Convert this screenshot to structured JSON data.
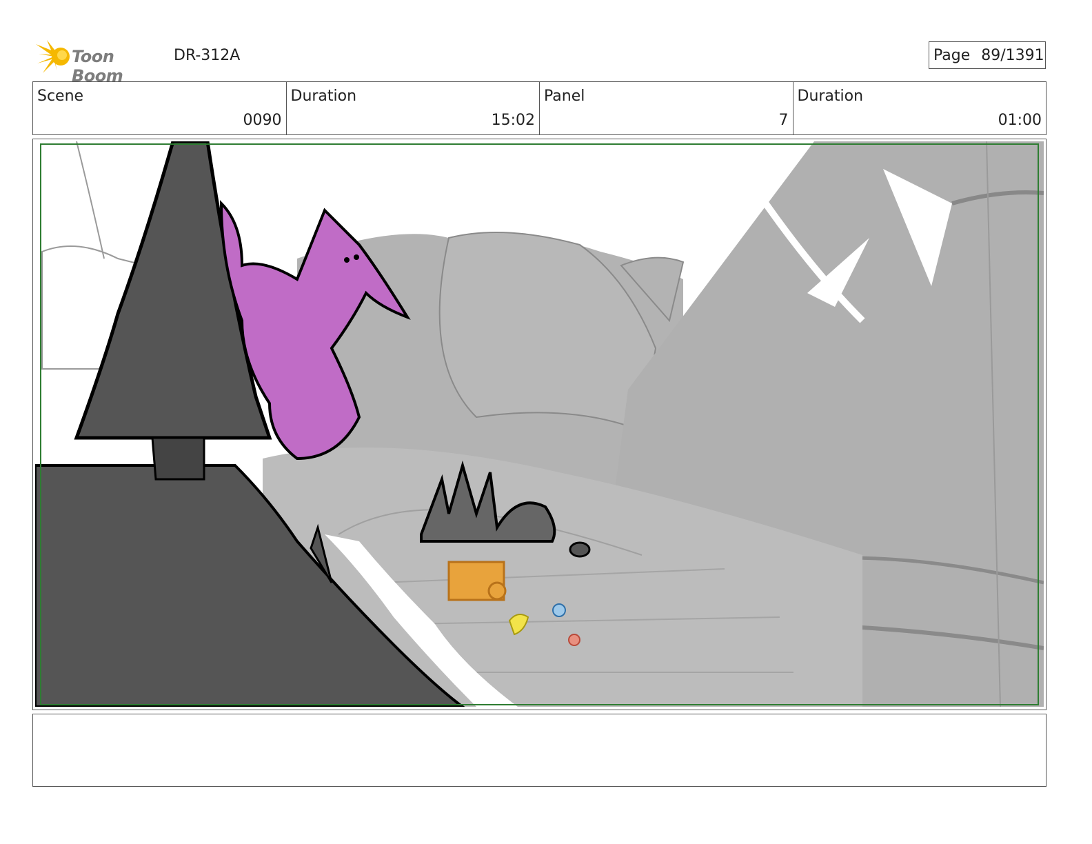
{
  "header": {
    "logo_text": "Toon Boom",
    "production_code": "DR-312A",
    "page_label": "Page",
    "page_value": "89/1391"
  },
  "info": {
    "scene_label": "Scene",
    "scene_value": "0090",
    "scene_duration_label": "Duration",
    "scene_duration_value": "15:02",
    "panel_label": "Panel",
    "panel_value": "7",
    "panel_duration_label": "Duration",
    "panel_duration_value": "01:00"
  },
  "notes": {
    "text": ""
  },
  "colors": {
    "logo_burst": "#f5b800",
    "safe_frame": "#2e7d32",
    "creature": "#c06cc6",
    "rock_dark": "#555555",
    "canyon_gray": "#b3b3b3",
    "truck": "#e8a33c"
  }
}
